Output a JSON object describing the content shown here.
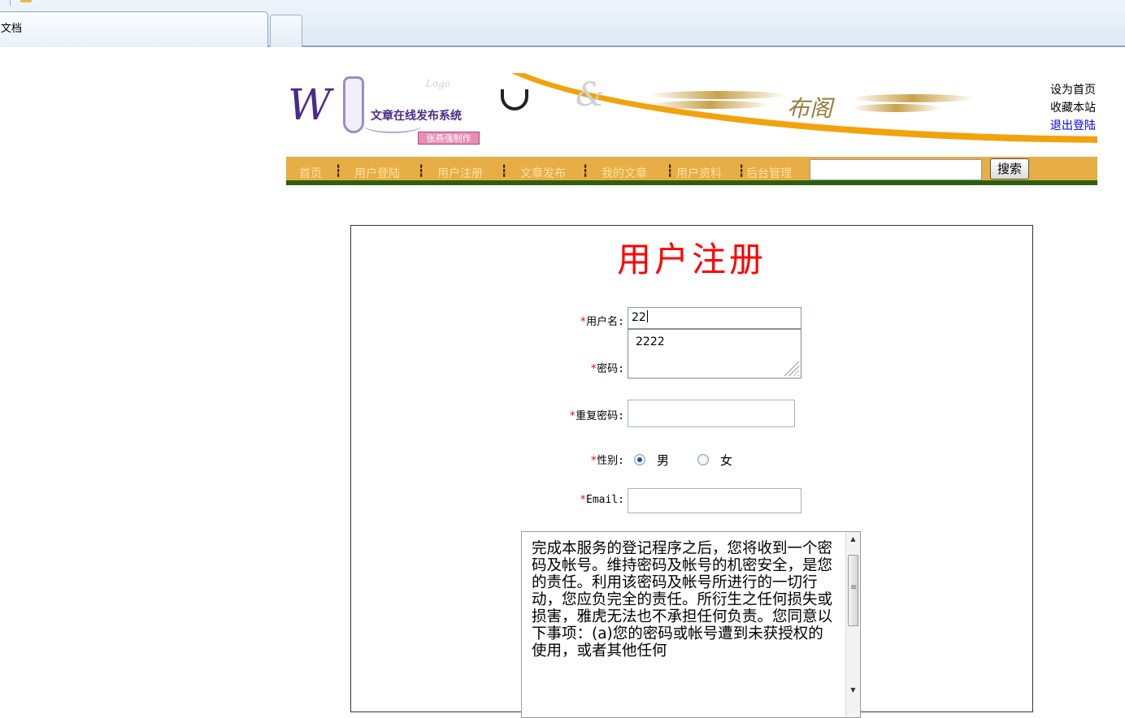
{
  "browser": {
    "tab_title": "文档"
  },
  "header": {
    "logo": {
      "title": "文章在线发布系统",
      "maker": "张燕强制作",
      "logo_word": "Logo"
    },
    "banner_text": "布阁",
    "top_links": {
      "set_home": "设为首页",
      "bookmark": "收藏本站",
      "logout": "退出登陆"
    }
  },
  "nav": {
    "items": [
      "首页",
      "用户登陆",
      "用户注册",
      "文章发布",
      "我的文章",
      "用户资料",
      "后台管理"
    ],
    "separator": "┇",
    "search_value": "",
    "search_button": "搜索"
  },
  "form": {
    "title": "用户注册",
    "required_mark": "*",
    "username_label": "用户名:",
    "username_value": "22",
    "password_label": "密码:",
    "password_value": "2222",
    "repeat_label": "重复密码:",
    "repeat_value": "",
    "gender_label": "性别:",
    "gender_options": [
      "男",
      "女"
    ],
    "gender_selected": "男",
    "email_label": "Email:",
    "email_value": "",
    "terms_text": "完成本服务的登记程序之后，您将收到一个密码及帐号。维持密码及帐号的机密安全，是您的责任。利用该密码及帐号所进行的一切行动，您应负完全的责任。所衍生之任何损失或损害，雅虎无法也不承担任何负责。您同意以下事项：(a)您的密码或帐号遭到未获授权的使用，或者其他任何"
  }
}
